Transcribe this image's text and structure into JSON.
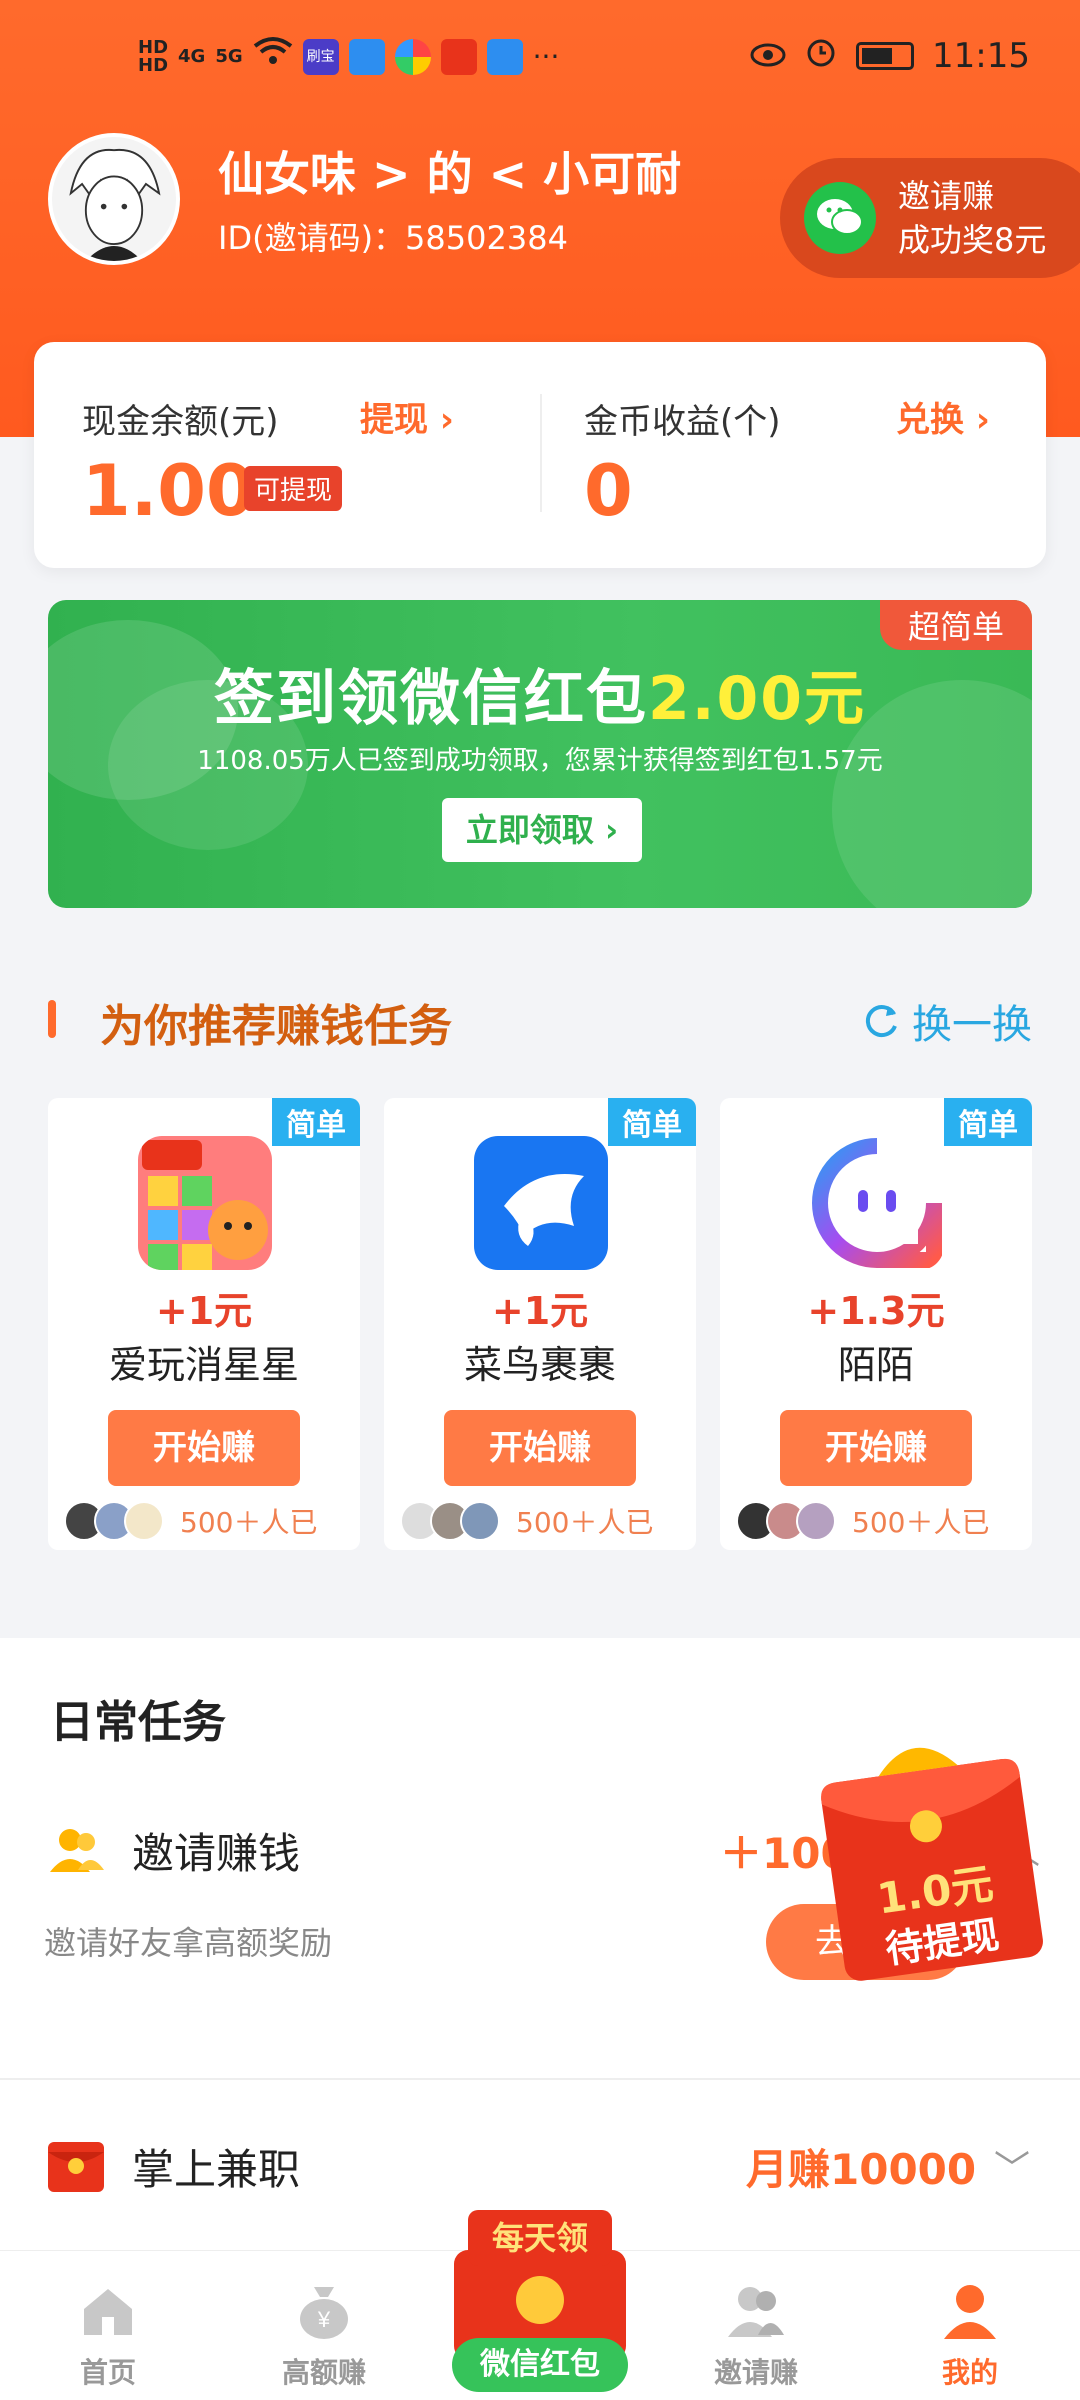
{
  "status_bar": {
    "time": "11:15",
    "network_1": "4G",
    "network_2": "5G",
    "app_tag": "刷宝",
    "more": "···"
  },
  "profile": {
    "username": "仙女味 > 的 < 小可耐",
    "id_text": "ID(邀请码)：58502384",
    "invite_line1": "邀请赚",
    "invite_line2": "成功奖8元"
  },
  "balance": {
    "cash_label": "现金余额(元)",
    "cash_link": "提现 ›",
    "cash_value": "1.00",
    "cash_badge": "可提现",
    "coin_label": "金币收益(个)",
    "coin_link": "兑换 ›",
    "coin_value": "0"
  },
  "banner": {
    "tag": "超简单",
    "title_main": "签到领微信红包",
    "title_amount": "2.00元",
    "subtitle": "1108.05万人已签到成功领取，您累计获得签到红包1.57元",
    "button": "立即领取 ›"
  },
  "recommend": {
    "title": "为你推荐赚钱任务",
    "refresh": "换一换",
    "tasks": [
      {
        "tag": "简单",
        "reward": "+1元",
        "name": "爱玩消星星",
        "button": "开始赚",
        "users": "500＋人已"
      },
      {
        "tag": "简单",
        "reward": "+1元",
        "name": "菜鸟裹裹",
        "button": "开始赚",
        "users": "500＋人已"
      },
      {
        "tag": "简单",
        "reward": "+1.3元",
        "name": "陌陌",
        "button": "开始赚",
        "users": "500＋人已"
      }
    ]
  },
  "daily": {
    "title": "日常任务",
    "rows": [
      {
        "title": "邀请赚钱",
        "reward": "＋100",
        "desc": "邀请好友拿高额奖励",
        "button": "去邀请"
      },
      {
        "title": "掌上兼职",
        "reward": "月赚10000"
      }
    ],
    "floating_packet": {
      "amount": "1.0元",
      "status": "待提现"
    }
  },
  "bottom_nav": {
    "items": [
      {
        "label": "首页"
      },
      {
        "label": "高额赚"
      },
      {
        "label": "邀请赚"
      },
      {
        "label": "我的"
      }
    ],
    "center_top": "每天领",
    "center_label": "微信红包"
  },
  "colors": {
    "brand_orange": "#ff6a2c",
    "banner_green": "#3ab956",
    "tag_blue": "#29b0f0",
    "reward_red": "#e8432b"
  }
}
